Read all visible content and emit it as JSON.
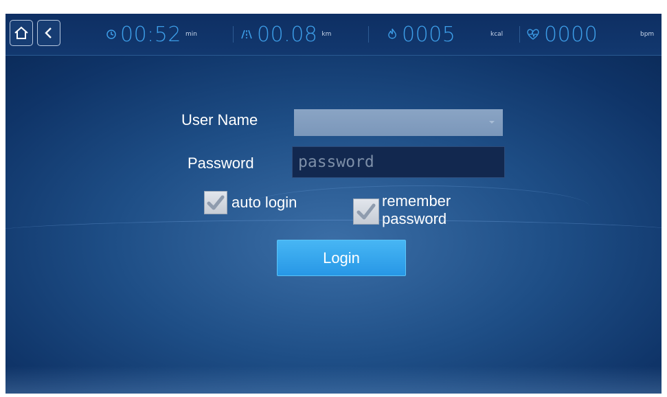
{
  "topbar": {
    "time": {
      "value": "00:52",
      "unit": "min"
    },
    "distance": {
      "value": "00.08",
      "unit": "km"
    },
    "calories": {
      "value": "0005",
      "unit": "kcal"
    },
    "heart_rate": {
      "value": "0000",
      "unit": "bpm"
    }
  },
  "form": {
    "username_label": "User Name",
    "username_value": "",
    "password_label": "Password",
    "password_placeholder": "password",
    "auto_login_label": "auto login",
    "auto_login_checked": true,
    "remember_label_line1": "remember",
    "remember_label_line2": "password",
    "remember_checked": true,
    "login_button": "Login"
  },
  "colors": {
    "accent": "#3d9ee8",
    "button": "#2f9fe9",
    "background": "#1e4e86"
  },
  "icons": [
    "home-icon",
    "back-icon",
    "clock-icon",
    "road-icon",
    "flame-icon",
    "heart-icon",
    "check-icon",
    "chevron-down-icon"
  ]
}
